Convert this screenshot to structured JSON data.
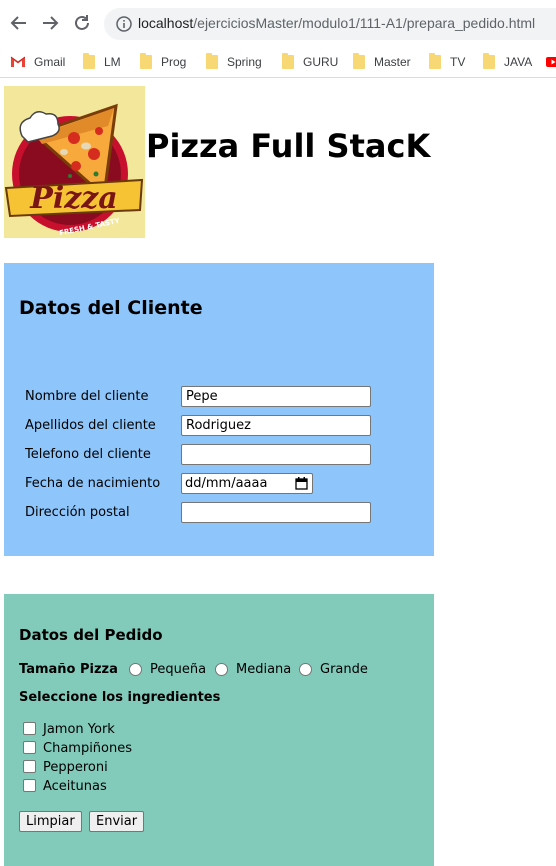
{
  "browser": {
    "url_host": "localhost",
    "url_path": "/ejerciciosMaster/modulo1/111-A1/prepara_pedido.html",
    "bookmarks": [
      "Gmail",
      "LM",
      "Prog",
      "Spring",
      "GURU",
      "Master",
      "TV",
      "JAVA"
    ]
  },
  "logo": {
    "brand": "Pizza",
    "tagline": "FRESH & TASTY"
  },
  "page_title": "Pizza Full StacK",
  "cliente": {
    "title": "Datos del Cliente",
    "fields": [
      {
        "label": "Nombre del cliente",
        "value": "Pepe"
      },
      {
        "label": "Apellidos del cliente",
        "value": "Rodriguez"
      },
      {
        "label": "Telefono del cliente",
        "value": ""
      },
      {
        "label": "Fecha de nacimiento",
        "value": "dd/mm/aaaa"
      },
      {
        "label": "Dirección postal",
        "value": ""
      }
    ]
  },
  "pedido": {
    "title": "Datos del Pedido",
    "size_label": "Tamaño Pizza",
    "sizes": [
      "Pequeña",
      "Mediana",
      "Grande"
    ],
    "ingredients_title": "Seleccione los ingredientes",
    "ingredients": [
      "Jamon York",
      "Champiñones",
      "Pepperoni",
      "Aceitunas"
    ],
    "reset_label": "Limpiar",
    "submit_label": "Enviar"
  },
  "colors": {
    "cliente_bg": "#8ec6fb",
    "pedido_bg": "#82cbbb",
    "logo_bg": "#f2e79a"
  }
}
